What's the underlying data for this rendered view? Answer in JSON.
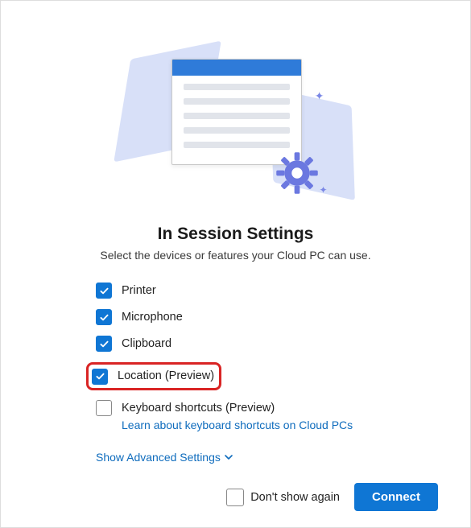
{
  "title": "In Session Settings",
  "subtitle": "Select the devices or features your Cloud PC can use.",
  "options": {
    "printer": {
      "label": "Printer",
      "checked": true
    },
    "microphone": {
      "label": "Microphone",
      "checked": true
    },
    "clipboard": {
      "label": "Clipboard",
      "checked": true
    },
    "location": {
      "label": "Location (Preview)",
      "checked": true,
      "highlighted": true
    },
    "keyboard": {
      "label": "Keyboard shortcuts (Preview)",
      "checked": false,
      "sublink": "Learn about keyboard shortcuts on Cloud PCs"
    }
  },
  "advanced_link": "Show Advanced Settings",
  "footer": {
    "dont_show_again": "Don't show again",
    "dont_show_again_checked": false,
    "connect_label": "Connect"
  },
  "colors": {
    "accent": "#0f76d4",
    "link": "#0f6cbd",
    "highlight": "#d92424"
  }
}
